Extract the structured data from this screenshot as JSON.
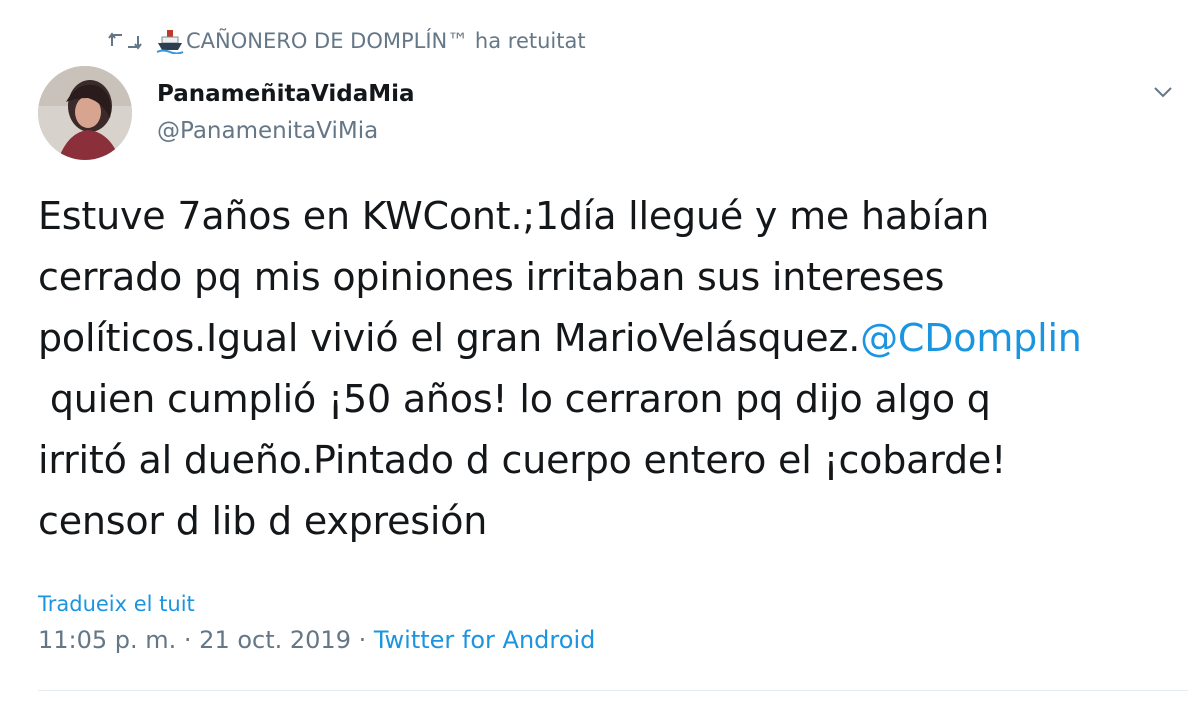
{
  "retweet_banner": {
    "icon": "retweet-icon",
    "emoji": "ship-emoji",
    "text": "CAÑONERO DE DOMPLÍN™ ha retuitat"
  },
  "author": {
    "display_name": "PanameñitaVidaMia",
    "handle": "@PanamenitaViMia"
  },
  "tweet": {
    "lines": [
      "Estuve 7años en KWCont.;1día llegué y me habían",
      "cerrado pq mis opiniones irritaban sus intereses",
      "políticos.Igual vivió el gran MarioVelásquez."
    ],
    "mention": "@CDomplin",
    "lines_after": [
      " quien cumplió ¡50 años! lo cerraron pq dijo algo q",
      "irritó al dueño.Pintado d cuerpo entero el ¡cobarde!",
      "censor d lib d expresión"
    ]
  },
  "translate_label": "Tradueix el tuit",
  "meta": {
    "timestamp": "11:05 p. m. · 21 oct. 2019 · ",
    "source": "Twitter for Android"
  },
  "colors": {
    "link": "#1b95e0",
    "muted": "#657786",
    "text": "#14171a"
  }
}
